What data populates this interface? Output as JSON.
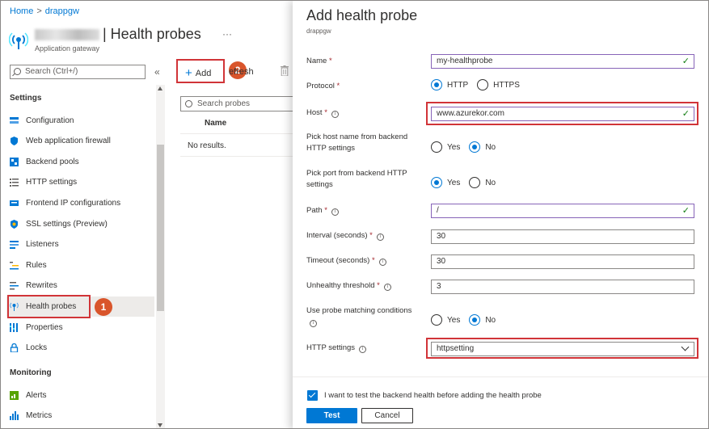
{
  "breadcrumb": {
    "home": "Home",
    "separator": ">",
    "current": "drappgw"
  },
  "resource": {
    "title": "| Health probes",
    "subtitle": "Application gateway",
    "more": "···"
  },
  "sidebar": {
    "search_placeholder": "Search (Ctrl+/)",
    "collapse": "«",
    "sections": [
      {
        "label": "Settings"
      },
      {
        "label": "Monitoring"
      }
    ],
    "items": [
      {
        "label": "Configuration",
        "icon": "configuration-icon"
      },
      {
        "label": "Web application firewall",
        "icon": "shield-icon"
      },
      {
        "label": "Backend pools",
        "icon": "backend-pools-icon"
      },
      {
        "label": "HTTP settings",
        "icon": "list-settings-icon"
      },
      {
        "label": "Frontend IP configurations",
        "icon": "frontend-ip-icon"
      },
      {
        "label": "SSL settings (Preview)",
        "icon": "ssl-shield-icon"
      },
      {
        "label": "Listeners",
        "icon": "listeners-icon"
      },
      {
        "label": "Rules",
        "icon": "rules-icon"
      },
      {
        "label": "Rewrites",
        "icon": "rewrites-icon"
      },
      {
        "label": "Health probes",
        "icon": "health-probe-icon",
        "active": true
      },
      {
        "label": "Properties",
        "icon": "properties-icon"
      },
      {
        "label": "Locks",
        "icon": "lock-icon"
      },
      {
        "label": "Alerts",
        "icon": "alerts-icon"
      },
      {
        "label": "Metrics",
        "icon": "metrics-icon"
      }
    ]
  },
  "annotations": {
    "badge1": "1",
    "badge2": "2",
    "color": "#d13438"
  },
  "toolbar": {
    "add_label": "Add",
    "refresh_label": "efresh"
  },
  "list": {
    "search_placeholder": "Search probes",
    "column_name": "Name",
    "empty_text": "No results."
  },
  "panel": {
    "title": "Add health probe",
    "subtitle": "drappgw",
    "name_label": "Name",
    "name_value": "my-healthprobe",
    "protocol_label": "Protocol",
    "protocol_options": [
      "HTTP",
      "HTTPS"
    ],
    "protocol_selected": "HTTP",
    "host_label": "Host",
    "host_value": "www.azurekor.com",
    "pick_host_label": "Pick host name from backend HTTP settings",
    "pick_host_options": [
      "Yes",
      "No"
    ],
    "pick_host_selected": "No",
    "pick_port_label": "Pick port from backend HTTP settings",
    "pick_port_options": [
      "Yes",
      "No"
    ],
    "pick_port_selected": "Yes",
    "path_label": "Path",
    "path_value": "/",
    "interval_label": "Interval (seconds)",
    "interval_value": "30",
    "timeout_label": "Timeout (seconds)",
    "timeout_value": "30",
    "unhealthy_label": "Unhealthy threshold",
    "unhealthy_value": "3",
    "matching_label": "Use probe matching conditions",
    "matching_options": [
      "Yes",
      "No"
    ],
    "matching_selected": "No",
    "http_settings_label": "HTTP settings",
    "http_settings_value": "httpsetting",
    "required_mark": "*",
    "info_glyph": "i",
    "check_glyph": "✓",
    "test_checkbox_label": "I want to test the backend health before adding the health probe",
    "test_button": "Test",
    "cancel_button": "Cancel"
  }
}
